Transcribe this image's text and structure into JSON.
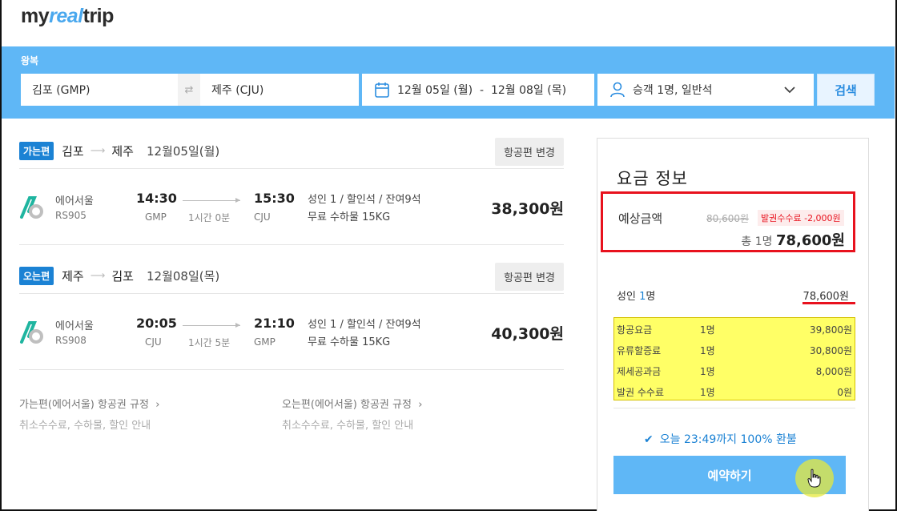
{
  "header": {
    "logo_left": "my",
    "logo_accent": "real",
    "logo_right": "trip"
  },
  "search": {
    "trip_type": "왕복",
    "from": "김포 (GMP)",
    "swap_icon": "⇄",
    "to": "제주 (CJU)",
    "dates": "12월 05일 (월)  -  12월 08일 (목)",
    "passengers": "승객 1명, 일반석",
    "search_button": "검색"
  },
  "segments": [
    {
      "tag": "가는편",
      "from": "김포",
      "to": "제주",
      "date": "12월05일(월)",
      "change_button": "항공편 변경",
      "airline": "에어서울",
      "flight_no": "RS905",
      "dep_time": "14:30",
      "dep_code": "GMP",
      "duration": "1시간 0분",
      "arr_time": "15:30",
      "arr_code": "CJU",
      "seat_info": "성인 1 / 할인석 / 잔여9석",
      "baggage": "무료 수하물 15KG",
      "price": "38,300원"
    },
    {
      "tag": "오는편",
      "from": "제주",
      "to": "김포",
      "date": "12월08일(목)",
      "change_button": "항공편 변경",
      "airline": "에어서울",
      "flight_no": "RS908",
      "dep_time": "20:05",
      "dep_code": "CJU",
      "duration": "1시간 5분",
      "arr_time": "21:10",
      "arr_code": "GMP",
      "seat_info": "성인 1 / 할인석 / 잔여9석",
      "baggage": "무료 수하물 15KG",
      "price": "40,300원"
    }
  ],
  "rules": [
    {
      "title": "가는편(에어서울) 항공권 규정  ›",
      "sub": "취소수수료, 수하물, 할인 안내"
    },
    {
      "title": "오는편(에어서울) 항공권 규정  ›",
      "sub": "취소수수료, 수하물, 할인 안내"
    }
  ],
  "fare": {
    "title": "요금 정보",
    "estimate_label": "예상금액",
    "original_price": "80,600원",
    "discount_badge": "발권수수료 -2,000원",
    "total_prefix": "총 1명",
    "total_amount": "78,600원",
    "adult_label": "성인",
    "adult_count": "1",
    "adult_unit": "명",
    "adult_amount": "78,600원",
    "breakdown": [
      {
        "name": "항공요금",
        "count": "1명",
        "amount": "39,800원"
      },
      {
        "name": "유류할증료",
        "count": "1명",
        "amount": "30,800원"
      },
      {
        "name": "제세공과금",
        "count": "1명",
        "amount": "8,000원"
      },
      {
        "name": "발권 수수료",
        "count": "1명",
        "amount": "0원"
      }
    ],
    "refund_check": "✔",
    "refund_notice": "오늘 23:49까지 100% 환불",
    "book_button": "예약하기"
  },
  "colors": {
    "accent": "#5fb7f6",
    "tag": "#1b82d4",
    "highlight_red": "#e8121e",
    "highlight_yellow": "#ffff66"
  }
}
